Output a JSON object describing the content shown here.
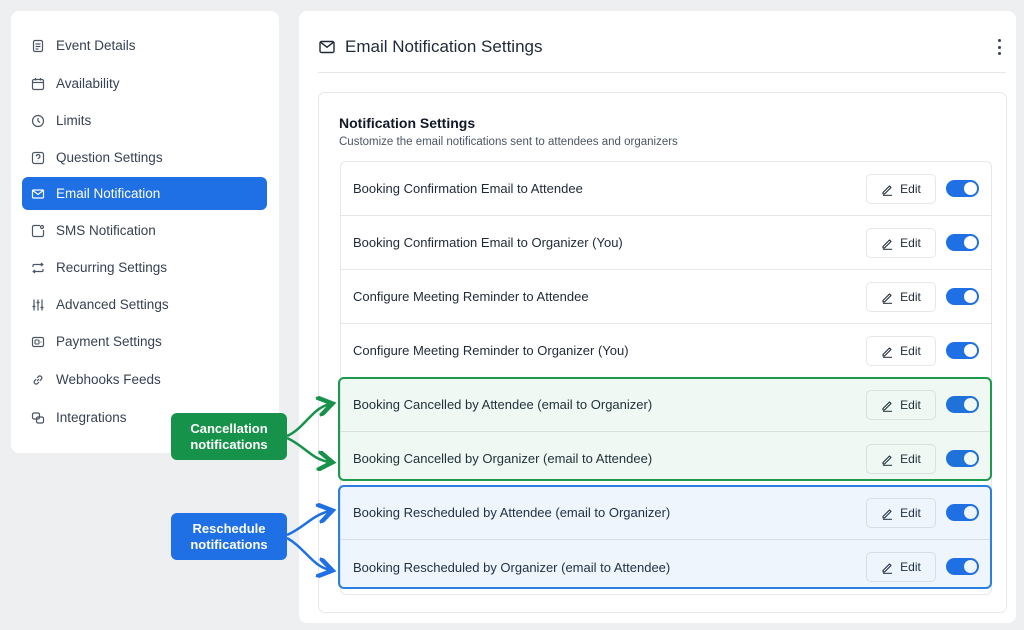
{
  "sidebar": {
    "items": [
      {
        "label": "Event Details",
        "icon": "document-icon"
      },
      {
        "label": "Availability",
        "icon": "calendar-icon"
      },
      {
        "label": "Limits",
        "icon": "clock-icon"
      },
      {
        "label": "Question Settings",
        "icon": "question-icon"
      },
      {
        "label": "Email Notification",
        "icon": "mail-icon",
        "active": true
      },
      {
        "label": "SMS Notification",
        "icon": "sms-icon"
      },
      {
        "label": "Recurring Settings",
        "icon": "repeat-icon"
      },
      {
        "label": "Advanced Settings",
        "icon": "sliders-icon"
      },
      {
        "label": "Payment Settings",
        "icon": "payment-icon"
      },
      {
        "label": "Webhooks Feeds",
        "icon": "link-icon"
      },
      {
        "label": "Integrations",
        "icon": "integrations-icon"
      }
    ]
  },
  "main": {
    "title": "Email Notification Settings",
    "card": {
      "title": "Notification Settings",
      "subtitle": "Customize the email notifications sent to attendees and organizers",
      "edit_label": "Edit",
      "rows": [
        {
          "label": "Booking Confirmation Email to Attendee",
          "enabled": true
        },
        {
          "label": "Booking Confirmation Email to Organizer (You)",
          "enabled": true
        },
        {
          "label": "Configure Meeting Reminder to Attendee",
          "enabled": true
        },
        {
          "label": "Configure Meeting Reminder to Organizer (You)",
          "enabled": true
        },
        {
          "label": "Booking Cancelled by Attendee (email to Organizer)",
          "enabled": true
        },
        {
          "label": "Booking Cancelled by Organizer (email to Attendee)",
          "enabled": true
        },
        {
          "label": "Booking Rescheduled by Attendee (email to Organizer)",
          "enabled": true
        },
        {
          "label": "Booking Rescheduled by Organizer (email to Attendee)",
          "enabled": true
        }
      ]
    }
  },
  "callouts": {
    "cancel": {
      "line1": "Cancellation",
      "line2": "notifications",
      "color": "#17924a"
    },
    "resched": {
      "line1": "Reschedule",
      "line2": "notifications",
      "color": "#1f6fe5"
    }
  },
  "colors": {
    "accent": "#1f6fe5",
    "cancel_border": "#1e9a4b",
    "resched_border": "#2a7fe0"
  }
}
